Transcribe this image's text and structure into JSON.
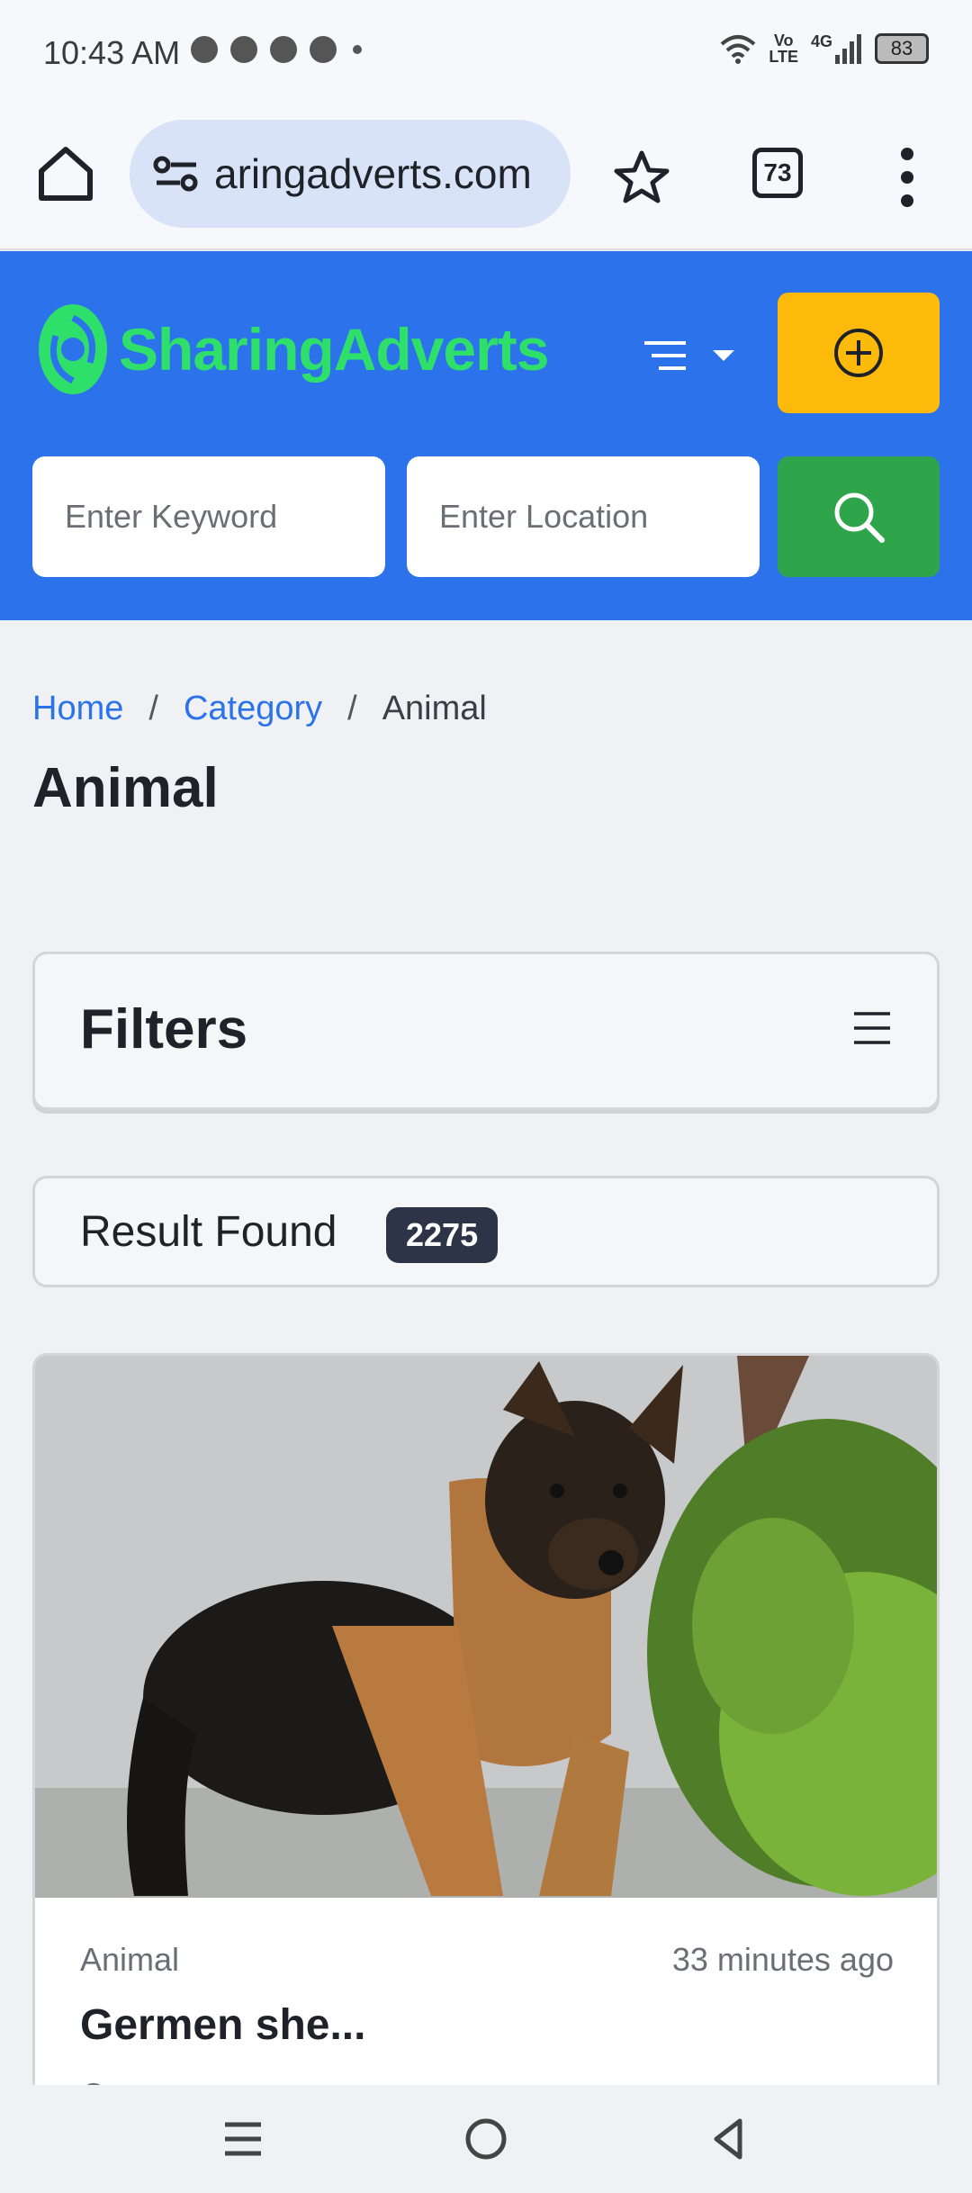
{
  "status_bar": {
    "time": "10:43 AM",
    "network_top": "Vo",
    "network_bottom": "LTE",
    "signal_label": "4G",
    "battery": "83"
  },
  "browser": {
    "url": "aringadverts.com",
    "tab_count": "73"
  },
  "site": {
    "logo_text_1": "Sharing",
    "logo_text_2": "Adverts",
    "keyword_placeholder": "Enter Keyword",
    "location_placeholder": "Enter Location",
    "colors": {
      "header": "#2c73eb",
      "logo": "#2ee06a",
      "post_button": "#fdba0b",
      "search_button": "#2ea54a",
      "badge": "#2d3448"
    }
  },
  "breadcrumb": {
    "home": "Home",
    "separator": "/",
    "category": "Category",
    "current": "Animal"
  },
  "page_title": "Animal",
  "filters": {
    "title": "Filters"
  },
  "results": {
    "label": "Result Found",
    "count": "2275"
  },
  "listing": {
    "image_subject": "German shepherd puppy",
    "category": "Animal",
    "time": "33 minutes ago",
    "title": "Germen she..."
  }
}
